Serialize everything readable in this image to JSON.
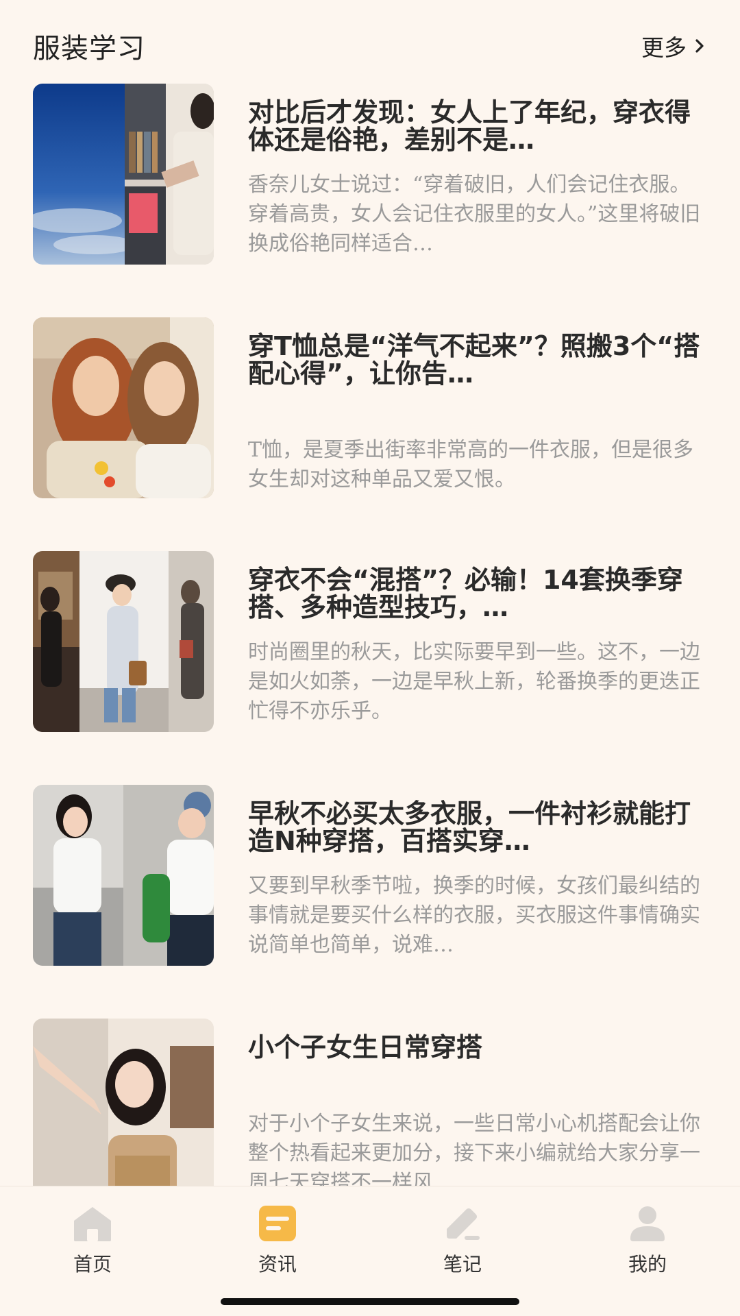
{
  "header": {
    "title": "服装学习",
    "more_label": "更多"
  },
  "articles": [
    {
      "title": "对比后才发现：女人上了年纪，穿衣得体还是俗艳，差别不是…",
      "summary": "香奈儿女士说过：“穿着破旧，人们会记住衣服。穿着高贵，女人会记住衣服里的女人。”这里将破旧换成俗艳同样适合…"
    },
    {
      "title": "穿T恤总是“洋气不起来”？照搬3个“搭配心得”，让你告…",
      "summary": "T恤，是夏季出街率非常高的一件衣服，但是很多女生却对这种单品又爱又恨。"
    },
    {
      "title": "穿衣不会“混搭”？必输！14套换季穿搭、多种造型技巧，…",
      "summary": "时尚圈里的秋天，比实际要早到一些。这不，一边是如火如荼，一边是早秋上新，轮番换季的更迭正忙得不亦乐乎。"
    },
    {
      "title": "早秋不必买太多衣服，一件衬衫就能打造N种穿搭，百搭实穿…",
      "summary": "又要到早秋季节啦，换季的时候，女孩们最纠结的事情就是要买什么样的衣服，买衣服这件事情确实说简单也简单，说难…"
    },
    {
      "title": "小个子女生日常穿搭",
      "summary": "对于小个子女生来说，一些日常小心机搭配会让你整个热看起来更加分，接下来小编就给大家分享一周七天穿搭不一样风…"
    }
  ],
  "tabbar": {
    "items": [
      {
        "label": "首页",
        "icon": "home-icon"
      },
      {
        "label": "资讯",
        "icon": "news-icon"
      },
      {
        "label": "笔记",
        "icon": "note-icon"
      },
      {
        "label": "我的",
        "icon": "profile-icon"
      }
    ],
    "active_index": 1
  },
  "colors": {
    "background": "#fdf6ef",
    "accent": "#f6b948",
    "inactive_icon": "#d9d5d1"
  }
}
